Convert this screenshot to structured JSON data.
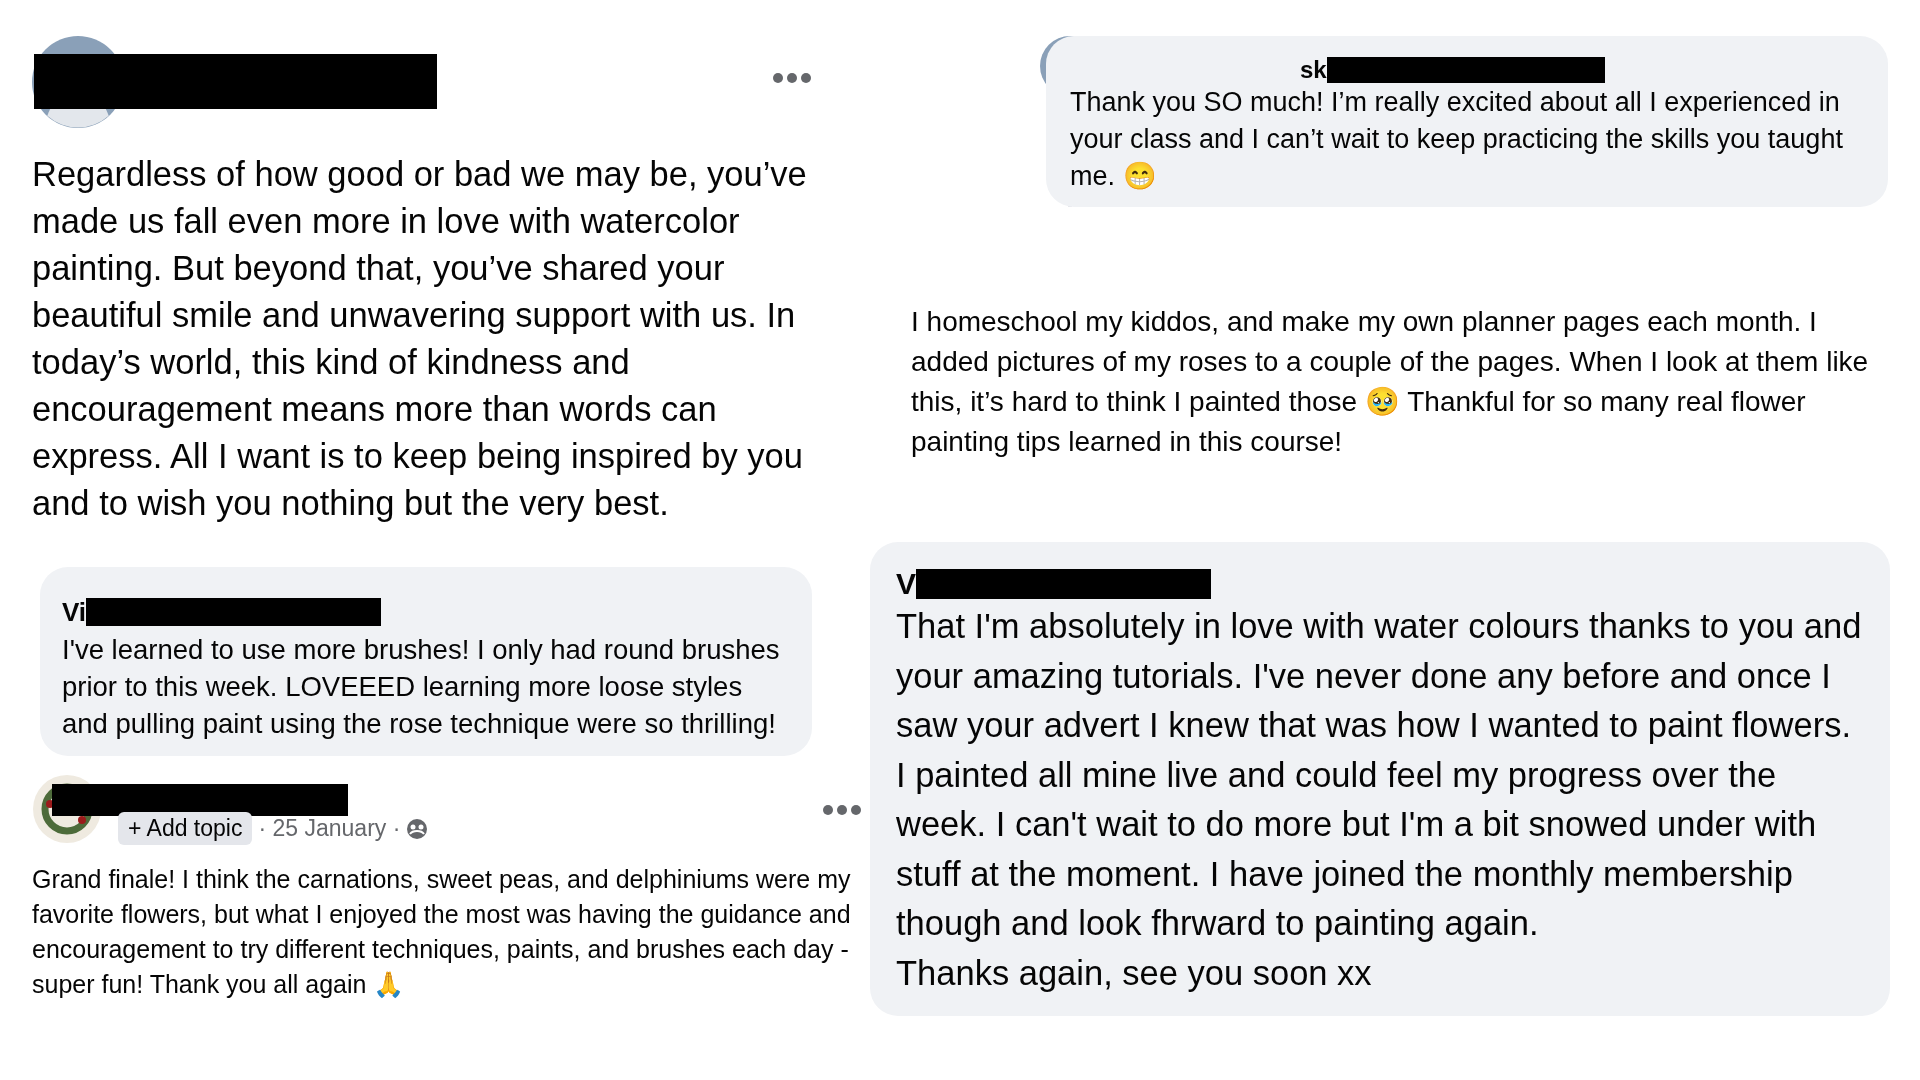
{
  "main_post": {
    "text": "Regardless of how good or bad we may be, you’ve made us fall even more in love with watercolor painting. But beyond that, you’ve shared your beautiful smile and unwavering support with us. In today’s world, this kind of kindness and encouragement means more than words can express. All I want is to keep being inspired by you and to wish you nothing but the very best."
  },
  "left_comment": {
    "name_fragment": "Vi",
    "text": "I've learned to use more brushes! I only had round brushes prior to this week. LOVEEED learning more loose styles and pulling paint using the rose technique were so thrilling!"
  },
  "post": {
    "add_topic": "+ Add topic",
    "meta": "· 25 January ·",
    "text": "Grand finale!  I think the carnations, sweet peas, and delphiniums were my favorite flowers, but what I enjoyed the most was having the guidance and encouragement to try different techniques, paints, and brushes each day - super fun!  Thank you all again 🙏"
  },
  "reply": {
    "name_fragment": "sk",
    "text": "Thank you SO much! I’m really excited about all I experienced in your class and I can’t wait to keep practicing the skills you taught me. 😁"
  },
  "paragraph": "I homeschool my kiddos, and make my own planner pages each month. I added pictures of my roses to a couple of the pages. When I look at them like this, it’s hard to think I painted those 🥹 Thankful for so many real flower painting tips learned in this course!",
  "right_comment": {
    "name_fragment": "V",
    "text": "That I'm absolutely in love with water colours thanks to you and your amazing tutorials. I've never done any before and once I saw your advert I knew that was how I wanted to paint flowers. I painted all mine live and could feel my progress over the week. I can't wait to do more but I'm a bit snowed under with stuff at the moment. I have joined the monthly membership though and look fhrward to painting again.\nThanks again, see you soon xx"
  }
}
